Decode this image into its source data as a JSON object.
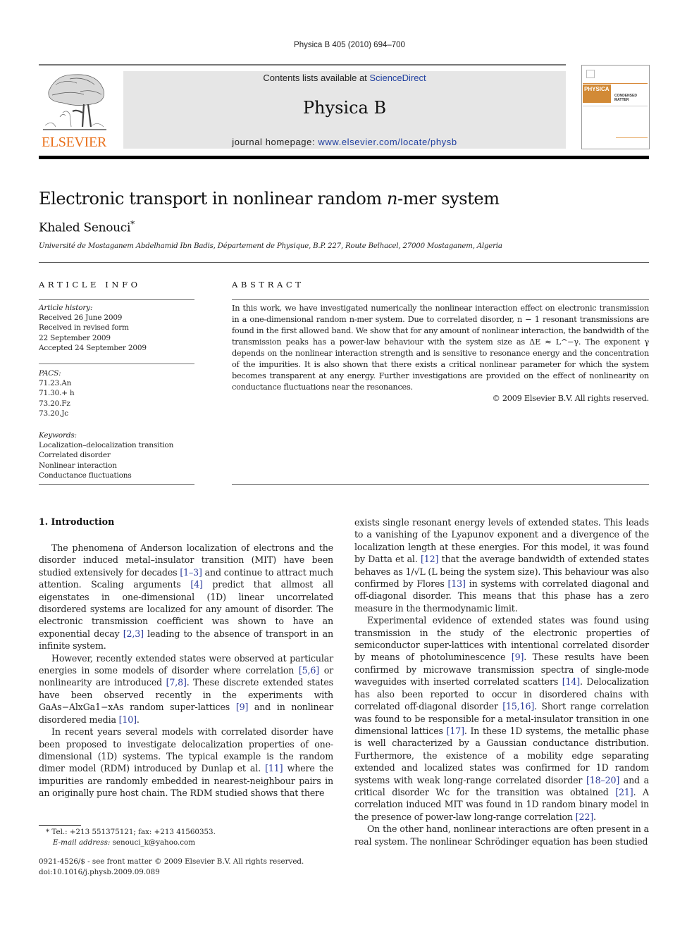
{
  "header": {
    "running_head": "Physica B 405 (2010) 694–700",
    "publisher_logo_text": "ELSEVIER",
    "contents_prefix": "Contents lists available at ",
    "contents_link": "ScienceDirect",
    "journal_name": "Physica B",
    "homepage_prefix": "journal homepage: ",
    "homepage_link": "www.elsevier.com/locate/physb",
    "cover_title": "PHYSICA",
    "cover_subtitle": "CONDENSED MATTER"
  },
  "article": {
    "title_before": "Electronic transport in nonlinear random ",
    "title_italic": "n",
    "title_after": "-mer system",
    "author": "Khaled Senouci",
    "author_mark": "*",
    "affiliation": "Université de Mostaganem Abdelhamid Ibn Badis, Département de Physique, B.P. 227, Route Belhacel, 27000 Mostaganem, Algeria"
  },
  "article_info": {
    "label": "ARTICLE INFO",
    "history_heading": "Article history:",
    "history": [
      "Received 26 June 2009",
      "Received in revised form",
      "22 September 2009",
      "Accepted 24 September 2009"
    ],
    "pacs_heading": "PACS:",
    "pacs": [
      "71.23.An",
      "71.30.+ h",
      "73.20.Fz",
      "73.20.Jc"
    ],
    "keywords_heading": "Keywords:",
    "keywords": [
      "Localization–delocalization transition",
      "Correlated disorder",
      "Nonlinear interaction",
      "Conductance fluctuations"
    ]
  },
  "abstract": {
    "label": "ABSTRACT",
    "text": "In this work, we have investigated numerically the nonlinear interaction effect on electronic transmission in a one-dimensional random n-mer system. Due to correlated disorder, n − 1 resonant transmissions are found in the first allowed band. We show that for any amount of nonlinear interaction, the bandwidth of the transmission peaks has a power-law behaviour with the system size as ΔE ≈ L^−γ. The exponent γ depends on the nonlinear interaction strength and is sensitive to resonance energy and the concentration of the impurities. It is also shown that there exists a critical nonlinear parameter for which the system becomes transparent at any energy. Further investigations are provided on the effect of nonlinearity on conductance fluctuations near the resonances.",
    "copyright": "© 2009 Elsevier B.V. All rights reserved."
  },
  "body": {
    "section_heading": "1.  Introduction",
    "left_paragraphs": [
      [
        "The phenomena of Anderson localization of electrons and the disorder induced metal–insulator transition (MIT) have been studied extensively for decades ",
        {
          "ref": "[1–3]"
        },
        " and continue to attract much attention. Scaling arguments ",
        {
          "ref": "[4]"
        },
        " predict that allmost all eigenstates in one-dimensional (1D) linear uncorrelated disordered systems are localized for any amount of disorder. The electronic transmission coefficient was shown to have an exponential decay ",
        {
          "ref": "[2,3]"
        },
        " leading to the absence of transport in an infinite system."
      ],
      [
        "However, recently extended states were observed at particular energies in some models of disorder where correlation ",
        {
          "ref": "[5,6]"
        },
        " or nonlinearity are introduced ",
        {
          "ref": "[7,8]"
        },
        ". These discrete extended states have been observed recently in the experiments with GaAs−AlxGa1−xAs random super-lattices ",
        {
          "ref": "[9]"
        },
        " and in nonlinear disordered media ",
        {
          "ref": "[10]"
        },
        "."
      ],
      [
        "In recent years several models with correlated disorder have been proposed to investigate delocalization properties of one-dimensional (1D) systems. The typical example is the random dimer model (RDM) introduced by Dunlap et al. ",
        {
          "ref": "[11]"
        },
        " where the impurities are randomly embedded in nearest-neighbour pairs in an originally pure host chain. The RDM studied shows that there"
      ]
    ],
    "right_paragraphs": [
      [
        "exists single resonant energy levels of extended states. This leads to a vanishing of the Lyapunov exponent and a divergence of the localization length at these energies. For this model, it was found by Datta et al. ",
        {
          "ref": "[12]"
        },
        " that the average bandwidth of extended states behaves as 1/√L (L being the system size). This behaviour was also confirmed by Flores ",
        {
          "ref": "[13]"
        },
        " in systems with correlated diagonal and off-diagonal disorder. This means that this phase has a zero measure in the thermodynamic limit."
      ],
      [
        "Experimental evidence of extended states was found using transmission in the study of the electronic properties of semiconductor super-lattices with intentional correlated disorder by means of photoluminescence ",
        {
          "ref": "[9]"
        },
        ". These results have been confirmed by microwave transmission spectra of single-mode waveguides with inserted correlated scatters ",
        {
          "ref": "[14]"
        },
        ". Delocalization has also been reported to occur in disordered chains with correlated off-diagonal disorder ",
        {
          "ref": "[15,16]"
        },
        ". Short range correlation was found to be responsible for a metal-insulator transition in one dimensional lattices ",
        {
          "ref": "[17]"
        },
        ". In these 1D systems, the metallic phase is well characterized by a Gaussian conductance distribution. Furthermore, the existence of a mobility edge separating extended and localized states was confirmed for 1D random systems with weak long-range correlated disorder ",
        {
          "ref": "[18–20]"
        },
        " and a critical disorder Wc for the transition was obtained ",
        {
          "ref": "[21]"
        },
        ". A correlation induced MIT was found in 1D random binary model in the presence of power-law long-range correlation ",
        {
          "ref": "[22]"
        },
        "."
      ],
      [
        "On the other hand, nonlinear interactions are often present in a real system. The nonlinear Schrödinger equation has been studied"
      ]
    ]
  },
  "footnote": {
    "contact": "* Tel.: +213 551375121; fax: +213 41560353.",
    "email_label": "E-mail address:",
    "email": "senouci_k@yahoo.com"
  },
  "front_matter": {
    "issn_line": "0921-4526/$ - see front matter © 2009 Elsevier B.V. All rights reserved.",
    "doi": "doi:10.1016/j.physb.2009.09.089"
  },
  "colors": {
    "link": "#1f3fa0",
    "elsevier_orange": "#e9711c",
    "banner_gray": "#e6e6e6"
  }
}
